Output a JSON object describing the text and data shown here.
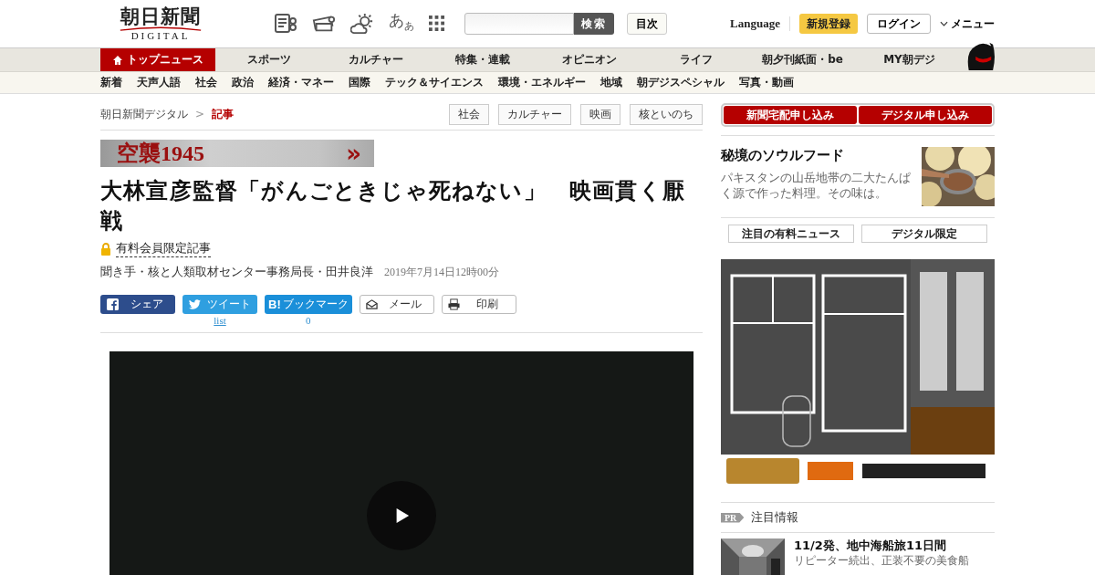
{
  "logo": {
    "title": "朝日新聞",
    "subtitle": "DIGITAL"
  },
  "font_size_button": "あ$_{あ}$",
  "search": {
    "button": "検索"
  },
  "index_button": "目次",
  "language": "Language",
  "register": "新規登録",
  "login": "ログイン",
  "menu": "メニュー",
  "main_nav": [
    {
      "label": "トップニュース",
      "selected": true
    },
    {
      "label": "スポーツ",
      "selected": false
    },
    {
      "label": "カルチャー",
      "selected": false
    },
    {
      "label": "特集・連載",
      "selected": false
    },
    {
      "label": "オピニオン",
      "selected": false
    },
    {
      "label": "ライフ",
      "selected": false
    },
    {
      "label": "朝夕刊紙面・be",
      "selected": false
    },
    {
      "label": "MY朝デジ",
      "selected": false
    }
  ],
  "sub_nav": [
    "新着",
    "天声人語",
    "社会",
    "政治",
    "経済・マネー",
    "国際",
    "テック＆サイエンス",
    "環境・エネルギー",
    "地域",
    "朝デジスペシャル",
    "写真・動画"
  ],
  "breadcrumb": {
    "home": "朝日新聞デジタル",
    "separator": ">",
    "current": "記事"
  },
  "tags": [
    "社会",
    "カルチャー",
    "映画",
    "核といのち"
  ],
  "series_banner": {
    "title": "空襲1945",
    "arrow": "»"
  },
  "article": {
    "title": "大林宣彦監督「がんごときじゃ死ねない」　映画貫く厭戦",
    "premium": "有料会員限定記事",
    "byline": "聞き手・核と人類取材センター事務局長・田井良洋",
    "date": "2019年7月14日12時00分"
  },
  "share": [
    {
      "kind": "facebook",
      "label": "シェア"
    },
    {
      "kind": "twitter",
      "label": "ツイート",
      "count": "list"
    },
    {
      "kind": "hatena",
      "label": "ブックマーク",
      "icon_text": "B!",
      "count": "0"
    },
    {
      "kind": "mail",
      "label": "メール"
    },
    {
      "kind": "print",
      "label": "印刷"
    }
  ],
  "video": {
    "kind": "video"
  },
  "subscribe": [
    "新聞宅配申し込み",
    "デジタル申し込み"
  ],
  "feature": {
    "title": "秘境のソウルフード",
    "text": "パキスタンの山岳地帯の二大たんぱく源で作った料理。その味は。"
  },
  "sidebar_tabs": [
    "注目の有料ニュース",
    "デジタル限定"
  ],
  "ad": {
    "kind": "picture"
  },
  "pr": {
    "badge": "PR",
    "heading": "注目情報",
    "items": [
      {
        "title": "11/2発、地中海船旅11日間",
        "text": "リピーター続出、正装不要の美食船"
      }
    ]
  }
}
